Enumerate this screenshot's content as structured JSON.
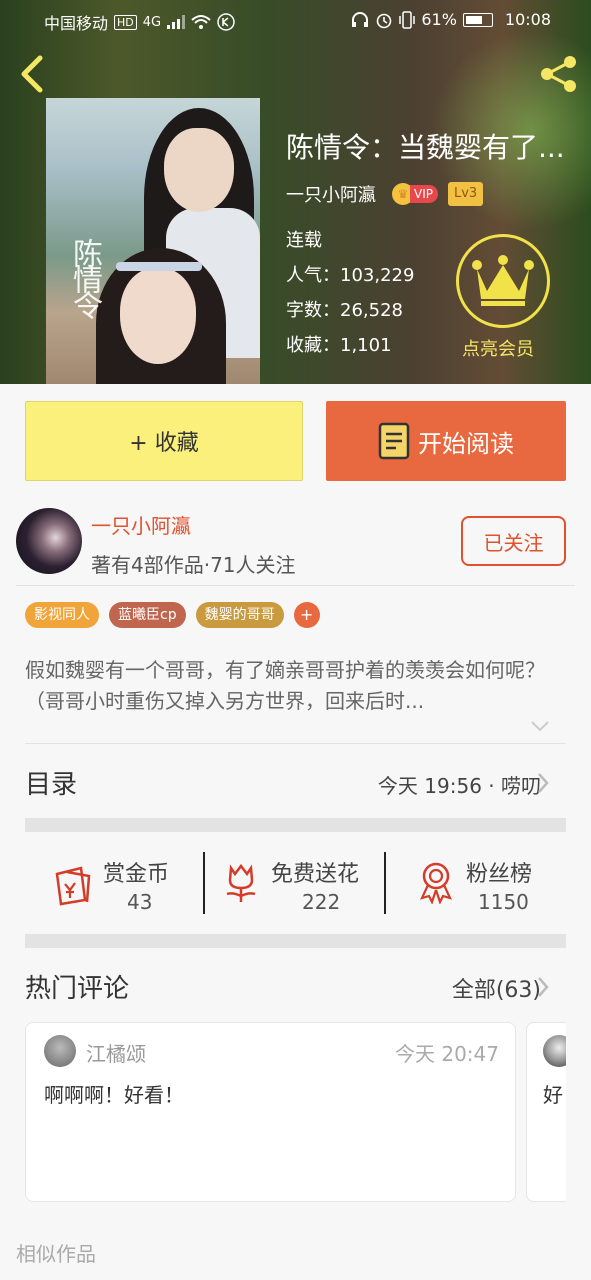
{
  "status_bar": {
    "carrier": "中国移动",
    "hd": "HD",
    "network": "4G",
    "battery": "61%",
    "time": "10:08"
  },
  "book": {
    "title": "陈情令：当魏婴有了...",
    "author": "一只小阿瀛",
    "vip_label": "VIP",
    "level": "Lv3",
    "status": "连载",
    "popularity": "人气：103,229",
    "word_count": "字数：26,528",
    "favorites": "收藏：1,101",
    "cover_calligraphy": "陈情令"
  },
  "member": {
    "label": "点亮会员"
  },
  "actions": {
    "collect": "+ 收藏",
    "read": "开始阅读"
  },
  "author_panel": {
    "name": "一只小阿瀛",
    "desc": "著有4部作品·71人关注",
    "follow": "已关注"
  },
  "tags": [
    {
      "label": "影视同人",
      "color": "#f0a43a"
    },
    {
      "label": "蓝曦臣cp",
      "color": "#c0664e"
    },
    {
      "label": "魏婴的哥哥",
      "color": "#c99a3e"
    }
  ],
  "tag_add": "+",
  "description": "假如魏婴有一个哥哥，有了嫡亲哥哥护着的羡羡会如何呢？（哥哥小时重伤又掉入另方世界，回来后时...",
  "toc": {
    "title": "目录",
    "update": "今天 19:56 · 唠叨"
  },
  "rewards": [
    {
      "label": "赏金币",
      "value": "43",
      "icon": "red-envelope-icon"
    },
    {
      "label": "免费送花",
      "value": "222",
      "icon": "flower-icon"
    },
    {
      "label": "粉丝榜",
      "value": "1150",
      "icon": "medal-icon"
    }
  ],
  "hot_comments": {
    "title": "热门评论",
    "all": "全部(63)"
  },
  "comments": [
    {
      "user": "江橘颂",
      "time": "今天 20:47",
      "text": "啊啊啊！好看！"
    },
    {
      "user": "",
      "time": "",
      "text": "好"
    }
  ],
  "similar": "相似作品",
  "colors": {
    "accent": "#e0512e",
    "read_button": "#e8693f",
    "collect_button": "#fbf07c",
    "member_ring": "#f2e24a"
  }
}
